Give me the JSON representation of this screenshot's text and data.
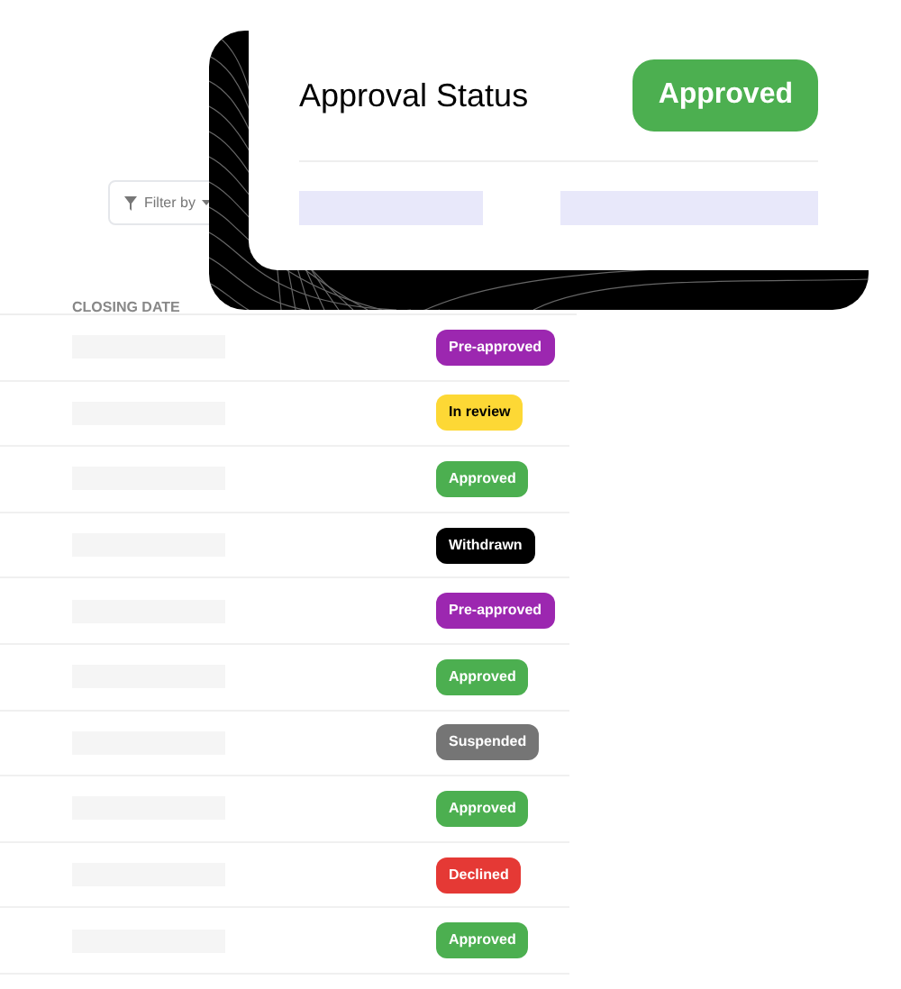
{
  "filter": {
    "label": "Filter by"
  },
  "table": {
    "column_header": "CLOSING DATE",
    "rows": [
      {
        "status": "Pre-approved",
        "color": "#9c27b0"
      },
      {
        "status": "In review",
        "color": "#fdd835"
      },
      {
        "status": "Approved",
        "color": "#4caf50"
      },
      {
        "status": "Withdrawn",
        "color": "#000000"
      },
      {
        "status": "Pre-approved",
        "color": "#9c27b0"
      },
      {
        "status": "Approved",
        "color": "#4caf50"
      },
      {
        "status": "Suspended",
        "color": "#757575"
      },
      {
        "status": "Approved",
        "color": "#4caf50"
      },
      {
        "status": "Declined",
        "color": "#e53935"
      },
      {
        "status": "Approved",
        "color": "#4caf50"
      }
    ]
  },
  "card": {
    "title": "Approval Status",
    "status": "Approved",
    "color": "#4caf50"
  }
}
